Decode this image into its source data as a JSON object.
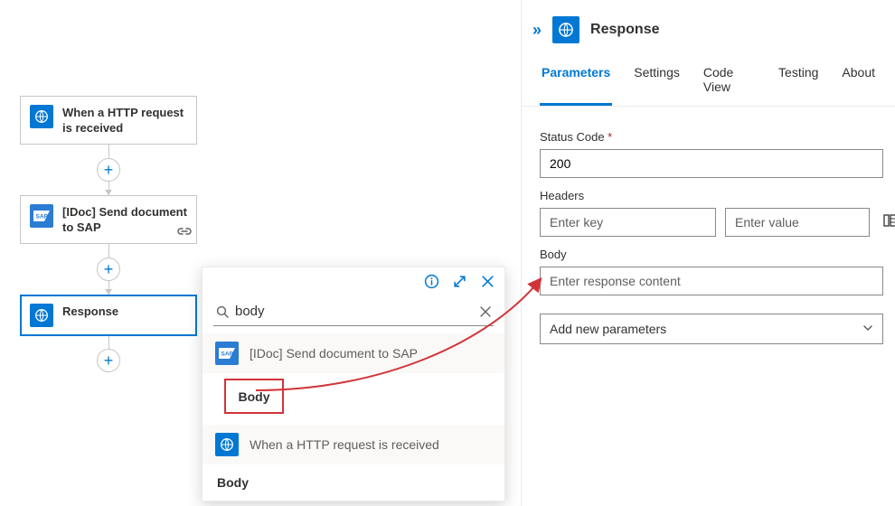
{
  "workflow": {
    "nodes": [
      {
        "type": "request",
        "label": "When a HTTP request is received"
      },
      {
        "type": "sap",
        "label": "[IDoc] Send document to SAP"
      },
      {
        "type": "request",
        "label": "Response"
      }
    ]
  },
  "picker": {
    "search_value": "body",
    "groups": [
      {
        "icon": "sap",
        "header": "[IDoc] Send document to SAP",
        "item": "Body",
        "highlighted": true
      },
      {
        "icon": "request",
        "header": "When a HTTP request is received",
        "item": "Body",
        "highlighted": false
      }
    ]
  },
  "panel": {
    "title": "Response",
    "tabs": [
      "Parameters",
      "Settings",
      "Code View",
      "Testing",
      "About"
    ],
    "active_tab": "Parameters",
    "fields": {
      "status_label": "Status Code",
      "status_value": "200",
      "headers_label": "Headers",
      "headers_key_placeholder": "Enter key",
      "headers_val_placeholder": "Enter value",
      "body_label": "Body",
      "body_placeholder": "Enter response content",
      "add_params_label": "Add new parameters"
    }
  }
}
